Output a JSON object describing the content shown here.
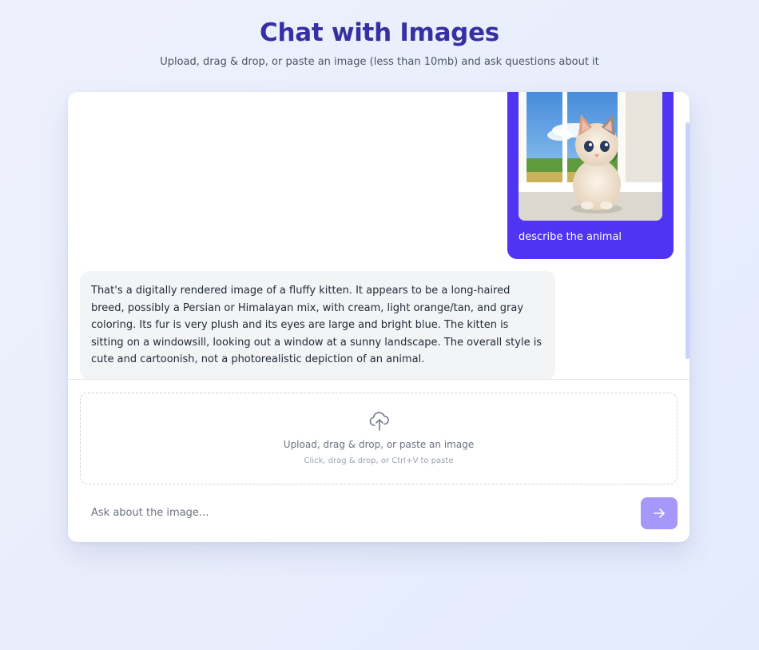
{
  "header": {
    "title": "Chat with Images",
    "subtitle": "Upload, drag & drop, or paste an image (less than 10mb) and ask questions about it"
  },
  "chat": {
    "messages": [
      {
        "role": "user",
        "image": "kitten-on-windowsill-image",
        "text": "describe the animal"
      },
      {
        "role": "assistant",
        "text": "That's a digitally rendered image of a fluffy kitten.  It appears to be a long-haired breed, possibly a Persian or Himalayan mix, with cream, light orange/tan, and gray coloring.  Its fur is very plush and its eyes are large and bright blue. The kitten is sitting on a windowsill, looking out a window at a sunny landscape.  The overall style is cute and cartoonish, not a photorealistic depiction of an animal."
      }
    ]
  },
  "upload": {
    "icon": "cloud-upload-icon",
    "label": "Upload, drag & drop, or paste an image",
    "hint": "Click, drag & drop, or Ctrl+V to paste"
  },
  "composer": {
    "placeholder": "Ask about the image...",
    "send_icon": "arrow-right-icon"
  },
  "colors": {
    "accent": "#4f35f3",
    "title": "#3730a3",
    "send_button": "#a697fb",
    "assistant_bubble": "#f3f4f6"
  }
}
